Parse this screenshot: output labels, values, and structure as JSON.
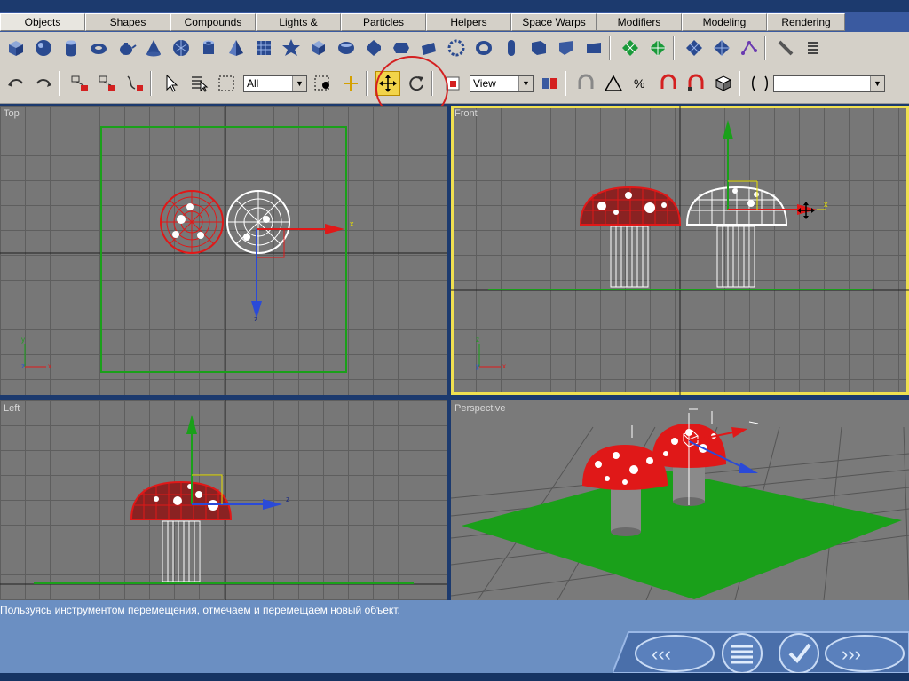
{
  "tabs": [
    "Objects",
    "Shapes",
    "Compounds",
    "Lights & Cameras",
    "Particles",
    "Helpers",
    "Space Warps",
    "Modifiers",
    "Modeling",
    "Rendering"
  ],
  "toolbar_main": {
    "selection_filter": "All",
    "reference_coord": "View",
    "named_selection": ""
  },
  "viewports": {
    "top": "Top",
    "front": "Front",
    "left": "Left",
    "perspective": "Perspective"
  },
  "axes": {
    "x": "x",
    "y": "y",
    "z": "z"
  },
  "status": {
    "caption": "Пользуясь инструментом перемещения, отмечаем и перемещаем новый объект."
  },
  "colors": {
    "accent_active_viewport": "#f0e050",
    "highlight_circle": "#d42020",
    "mushroom_red": "#e01818",
    "ground_green": "#1aa01a"
  }
}
